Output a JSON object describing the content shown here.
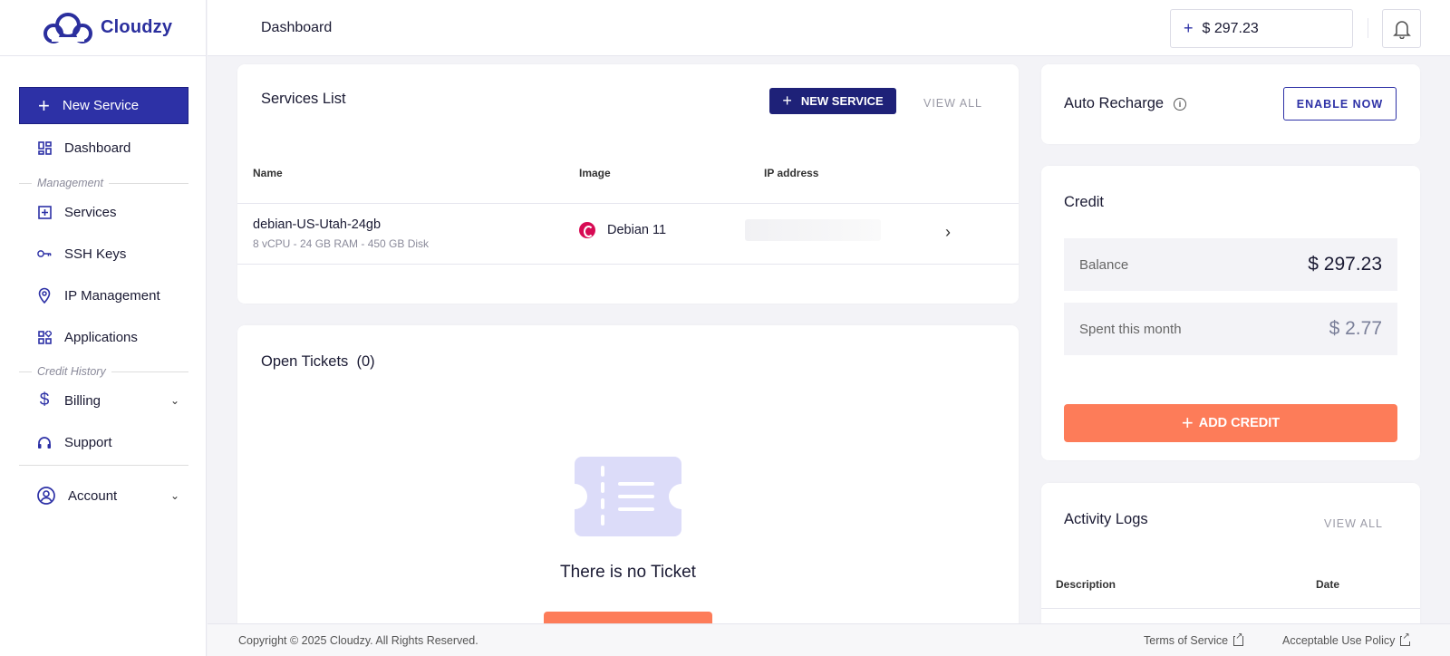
{
  "brand": {
    "name": "Cloudzy",
    "primary_color": "#2d31a6",
    "accent_color": "#fd7c59"
  },
  "sidebar": {
    "new_service_label": "New Service",
    "items": {
      "dashboard": "Dashboard",
      "services": "Services",
      "ssh_keys": "SSH Keys",
      "ip_management": "IP Management",
      "applications": "Applications",
      "billing": "Billing",
      "support": "Support",
      "account": "Account"
    },
    "sections": {
      "management": "Management",
      "credit_history": "Credit History"
    }
  },
  "topbar": {
    "title": "Dashboard",
    "balance": "$ 297.23",
    "bell_icon": "bell-icon"
  },
  "services": {
    "title": "Services List",
    "new_service_label": "NEW SERVICE",
    "view_all": "VIEW ALL",
    "columns": {
      "name": "Name",
      "image": "Image",
      "ip": "IP address"
    },
    "rows": [
      {
        "name": "debian-US-Utah-24gb",
        "spec": "8 vCPU - 24 GB RAM - 450 GB Disk",
        "image": "Debian 11",
        "ip": ""
      }
    ]
  },
  "tickets": {
    "title": "Open Tickets",
    "count": "(0)",
    "empty_text": "There is no Ticket"
  },
  "auto_recharge": {
    "title": "Auto Recharge",
    "enable_label": "ENABLE NOW"
  },
  "credit": {
    "title": "Credit",
    "balance_label": "Balance",
    "balance_value": "$ 297.23",
    "spent_label": "Spent this month",
    "spent_value": "$ 2.77",
    "add_credit_label": "ADD CREDIT"
  },
  "activity": {
    "title": "Activity Logs",
    "view_all": "VIEW ALL",
    "col_description": "Description",
    "col_date": "Date"
  },
  "footer": {
    "copyright": "Copyright © 2025 Cloudzy. All Rights Reserved.",
    "terms": "Terms of Service",
    "aup": "Acceptable Use Policy"
  }
}
